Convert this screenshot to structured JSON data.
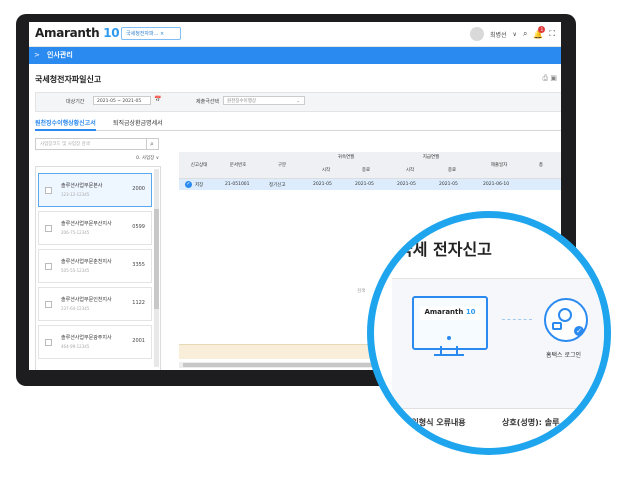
{
  "app": {
    "logo_text": "Amaranth",
    "logo_num": "10",
    "open_tab": "국세청전자파...",
    "open_tab_close": "×",
    "user_name": "최병선",
    "notif_count": "1"
  },
  "nav": {
    "chevron": ">",
    "title": "인사관리"
  },
  "page": {
    "title": "국세청전자파일신고"
  },
  "filter": {
    "period_label": "대상기간",
    "period_value": "2021-05 ~ 2021-05",
    "submit_label": "제출극선택",
    "submit_placeholder": "원천징수이행상"
  },
  "subtabs": {
    "active": "원천징수이행상황신고서",
    "inactive": "퇴직금상환금명세서"
  },
  "leftpanel": {
    "search_placeholder": "사업장코드 및 사업장 검색",
    "sort_label": "0. 사업장 ∨",
    "items": [
      {
        "name": "솔루션사업부문본사",
        "biz": "123-12-12345",
        "code": "2000"
      },
      {
        "name": "솔루션사업부문부산지사",
        "biz": "206-75-12345",
        "code": "0599"
      },
      {
        "name": "솔루션사업부문춘천지사",
        "biz": "505-55-12345",
        "code": "3355"
      },
      {
        "name": "솔루션사업부문인천지사",
        "biz": "237-64-12345",
        "code": "1122"
      },
      {
        "name": "솔루션사업부문광주지사",
        "biz": "464-99-12345",
        "code": "2001"
      }
    ]
  },
  "grid": {
    "headers": {
      "status": "신고상태",
      "doc_no": "문서번호",
      "type": "구분",
      "attr_month": "귀속연월",
      "pay_month": "지급연월",
      "start": "시작",
      "end": "종료",
      "submit_date": "제출일자",
      "total": "총"
    },
    "row": {
      "status": "저장",
      "doc_no": "21-051001",
      "type": "정기신고",
      "attr_start": "2021-05",
      "attr_end": "2021-05",
      "pay_start": "2021-05",
      "pay_end": "2021-05",
      "submit_date": "2021-06-10"
    },
    "side_label": "검색"
  },
  "magnifier": {
    "title": "국세 전자신고",
    "monitor_brand": "Amaranth",
    "monitor_num": "10",
    "login_label": "홈택스 로그인",
    "bottom_left": "파일형식 오류내용",
    "bottom_right": "상호(성명): 솔루"
  }
}
